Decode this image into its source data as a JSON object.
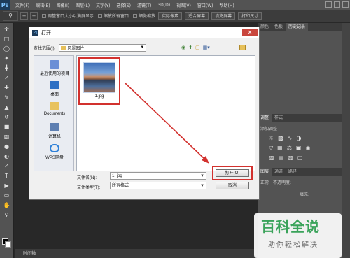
{
  "app": {
    "logo": "Ps",
    "menu": [
      "文件(F)",
      "编辑(E)",
      "图像(I)",
      "图层(L)",
      "文字(Y)",
      "选择(S)",
      "滤镜(T)",
      "3D(D)",
      "视图(V)",
      "窗口(W)",
      "帮助(H)"
    ]
  },
  "optbar": {
    "zoom_in": "+",
    "zoom_out": "−",
    "resize_windows": "调整窗口大小以满屏显示",
    "zoom_all": "缩放所有窗口",
    "scrubby": "细微缩放",
    "actual_pixels": "实际像素",
    "fit_screen": "适合屏幕",
    "fill_screen": "填充屏幕",
    "print_size": "打印尺寸"
  },
  "panels": {
    "top_tabs": [
      "颜色",
      "色板",
      "历史记录"
    ],
    "adjust_tabs": [
      "调整",
      "样式"
    ],
    "adjust_title": "添加调整",
    "layer_tabs": [
      "图层",
      "通道",
      "路径"
    ],
    "blend_mode": "正常",
    "opacity_label": "不透明度:",
    "fill_label": "填充:"
  },
  "statusbar": {
    "label": "时间轴"
  },
  "dialog": {
    "title": "打开",
    "look_in_label": "查找范围(I):",
    "look_in_value": "风景图片",
    "places": [
      "最近使用的项目",
      "桌面",
      "Documents",
      "计算机",
      "WPS网盘"
    ],
    "files": [
      {
        "name": "1.jpg"
      }
    ],
    "filename_label": "文件名(N):",
    "filename_value": "1. jpg",
    "filetype_label": "文件类型(T):",
    "filetype_value": "所有格式",
    "open_button": "打开(O)",
    "cancel_button": "取消"
  },
  "watermark": {
    "big": "百科全说",
    "small": "助你轻松解决"
  },
  "colors": {
    "highlight": "#d2312e",
    "watermark_green": "#3aa35a"
  }
}
